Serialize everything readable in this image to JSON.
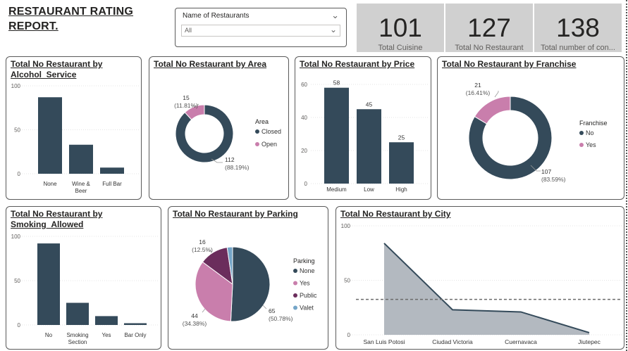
{
  "report_title": "RESTAURANT RATING REPORT.",
  "slicer": {
    "label": "Name of Restaurants",
    "value": "All"
  },
  "kpis": [
    {
      "value": "101",
      "label": "Total Cuisine"
    },
    {
      "value": "127",
      "label": "Total No Restaurant"
    },
    {
      "value": "138",
      "label": "Total number of con..."
    }
  ],
  "colors": {
    "dark": "#344a5a",
    "pink": "#c97eac",
    "purple": "#6b2d5c",
    "light_blue": "#74a5c8",
    "area_fill": "#b3b9c0"
  },
  "chart_data": [
    {
      "id": "alcohol",
      "type": "bar",
      "title": "Total No Restaurant by Alcohol_Service",
      "categories": [
        "None",
        "Wine & Beer",
        "Full Bar"
      ],
      "values": [
        87,
        33,
        7
      ],
      "ylim": [
        0,
        100
      ],
      "yticks": [
        0,
        50,
        100
      ],
      "grid": true
    },
    {
      "id": "area",
      "type": "pie",
      "title": "Total No Restaurant by Area",
      "legend_title": "Area",
      "slices": [
        {
          "label": "Closed",
          "value": 112,
          "percent": "(88.19%)"
        },
        {
          "label": "Open",
          "value": 15,
          "percent": "(11.81%)"
        }
      ]
    },
    {
      "id": "price",
      "type": "bar",
      "title": "Total No Restaurant by Price",
      "categories": [
        "Medium",
        "Low",
        "High"
      ],
      "values": [
        58,
        45,
        25
      ],
      "ylim": [
        0,
        60
      ],
      "yticks": [
        0,
        20,
        40,
        60
      ],
      "data_labels": true,
      "grid": true
    },
    {
      "id": "franchise",
      "type": "pie",
      "title": "Total No Restaurant by Franchise",
      "legend_title": "Franchise",
      "slices": [
        {
          "label": "No",
          "value": 107,
          "percent": "(83.59%)"
        },
        {
          "label": "Yes",
          "value": 21,
          "percent": "(16.41%)"
        }
      ]
    },
    {
      "id": "smoking",
      "type": "bar",
      "title": "Total No Restaurant by Smoking_Allowed",
      "categories": [
        "No",
        "Smoking Section",
        "Yes",
        "Bar Only"
      ],
      "values": [
        92,
        25,
        10,
        2
      ],
      "ylim": [
        0,
        100
      ],
      "yticks": [
        0,
        50,
        100
      ],
      "grid": true
    },
    {
      "id": "parking",
      "type": "pie",
      "title": "Total No Restaurant by Parking",
      "legend_title": "Parking",
      "slices": [
        {
          "label": "None",
          "value": 65,
          "percent": "(50.78%)"
        },
        {
          "label": "Yes",
          "value": 44,
          "percent": "(34.38%)"
        },
        {
          "label": "Public",
          "value": 16,
          "percent": "(12.5%)"
        },
        {
          "label": "Valet",
          "value": 3,
          "percent": ""
        }
      ]
    },
    {
      "id": "city",
      "type": "area",
      "title": "Total No Restaurant by City",
      "categories": [
        "San Luis Potosi",
        "Ciudad Victoria",
        "Cuernavaca",
        "Jiutepec"
      ],
      "values": [
        84,
        23,
        21,
        2
      ],
      "ylim": [
        0,
        100
      ],
      "yticks": [
        0,
        50,
        100
      ],
      "average_line": 32.5,
      "grid": true
    }
  ]
}
